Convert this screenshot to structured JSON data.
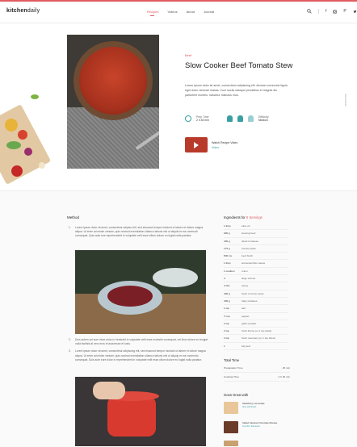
{
  "brand": {
    "name_bold": "kitchen",
    "name_light": "daily",
    "accent": "#e05b60",
    "teal": "#3aa0a4"
  },
  "nav": {
    "recipes": "Recipes",
    "videos": "Videos",
    "about": "About",
    "journal": "Journal"
  },
  "header_icons": [
    "search-icon",
    "facebook-icon",
    "instagram-icon",
    "pinterest-icon",
    "twitter-icon"
  ],
  "recipe": {
    "category": "Beef",
    "title": "Slow Cooker Beef Tomato Stew",
    "intro": "Lorem ipsum dolor sit amet, consectetur adipiscing elit. Aenean commodo ligula eget dolor. Aenean massa. Cum sociis natoque penatibus et magnis dis parturient montes, nascetur ridiculus mus.",
    "prep_label": "Prep Time",
    "prep_value": "2 h 45 min",
    "difficulty_label": "Difficulty",
    "difficulty_value": "Medium",
    "video_title": "Watch Recipe Video",
    "video_sub": "Video",
    "side_text": "Scroll Down"
  },
  "method": {
    "heading": "Method",
    "steps": [
      {
        "n": "1.",
        "text": "Lorem ipsum dolor sit amet, consectetur adipisci elit, sed eiusmod tempor incidunt ut labore et dolore magna aliqua. Ut enim ad minim veniam, quis nostrud exercitation ullamco laboris nisi ut aliquid ex ea commodi consequat. Quis aute iure reprehenderit in voluptate velit esse cillum dolore eu fugiat nulla pariatur."
      },
      {
        "n": "2.",
        "text": "Duis autem vel eum iriure dolor in hendrerit in vulputate velit esse molestie consequat, vel illum dolore eu feugiat nulla facilisis at vero eros et accumsan et iusto."
      },
      {
        "n": "3.",
        "text": "Lorem ipsum dolor sit amet, consectetur adipiscing elit, sed eiusmod tempor incidunt ut labore et dolore magna aliqua. Ut enim ad minim veniam, quis nostrud exercitation ullamco laboris nisi ut aliquip ex ea commodo consequat. Duis aute irure dolor in reprehenderit in voluptate velit esse cillum dolore eu fugiat nulla pariatur."
      }
    ]
  },
  "ingredients": {
    "heading": "Ingredients for",
    "servings": "6 Servings",
    "items": [
      {
        "q": "1 tbsp",
        "n": "olive oil"
      },
      {
        "q": "900 g",
        "n": "stewing beef"
      },
      {
        "q": "400 g",
        "n": "diced tomatoes"
      },
      {
        "q": "175 g",
        "n": "tomato paste"
      },
      {
        "q": "500 mL",
        "n": "beef broth"
      },
      {
        "q": "1 tbsp",
        "n": "worcestershire sauce"
      },
      {
        "q": "1 medium",
        "n": "onion"
      },
      {
        "q": "3",
        "n": "large carrots"
      },
      {
        "q": "3 ribs",
        "n": "celery"
      },
      {
        "q": "300 g",
        "n": "fresh or frozen peas"
      },
      {
        "q": "300 g",
        "n": "baby potatoes"
      },
      {
        "q": "1 tsp",
        "n": "salt"
      },
      {
        "q": "½ tsp",
        "n": "pepper"
      },
      {
        "q": "2 tsp",
        "n": "garlic powder"
      },
      {
        "q": "2 tsp",
        "n": "fresh thyme (or 1 tsp dried)"
      },
      {
        "q": "2 tsp",
        "n": "fresh rosemary (or 1 tsp dried)"
      },
      {
        "q": "1",
        "n": "bay leaf"
      }
    ]
  },
  "total_time": {
    "heading": "Total Time",
    "prep_label": "Preparation Time",
    "prep_value": "25 min",
    "cook_label": "Cooking Time",
    "cook_value": "2 h 20 min"
  },
  "goes_great": {
    "heading": "Goes Great with",
    "items": [
      {
        "title": "Strawberry Lemonade",
        "sub": "Non-Alcoholic"
      },
      {
        "title": "Salted Caramel Chocolate Mousse",
        "sub": "Comfort Desserts"
      }
    ]
  }
}
